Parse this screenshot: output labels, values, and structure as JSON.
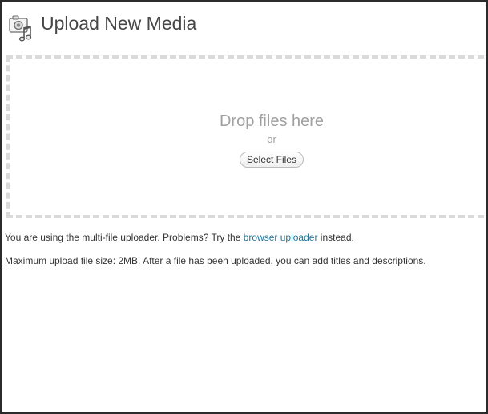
{
  "header": {
    "title": "Upload New Media",
    "icon": "media-library-icon"
  },
  "uploader": {
    "drop_text": "Drop files here",
    "or_text": "or",
    "select_button_label": "Select Files"
  },
  "info": {
    "multi_file_prefix": "You are using the multi-file uploader. Problems? Try the",
    "browser_uploader_link": "browser uploader",
    "multi_file_suffix": "instead.",
    "max_size_text": "Maximum upload file size: 2MB. After a file has been uploaded, you can add titles and descriptions."
  },
  "colors": {
    "link": "#21759b",
    "dashed_border": "#dadada",
    "drop_text": "#a0a0a0",
    "frame_border": "#2b2b2b"
  }
}
